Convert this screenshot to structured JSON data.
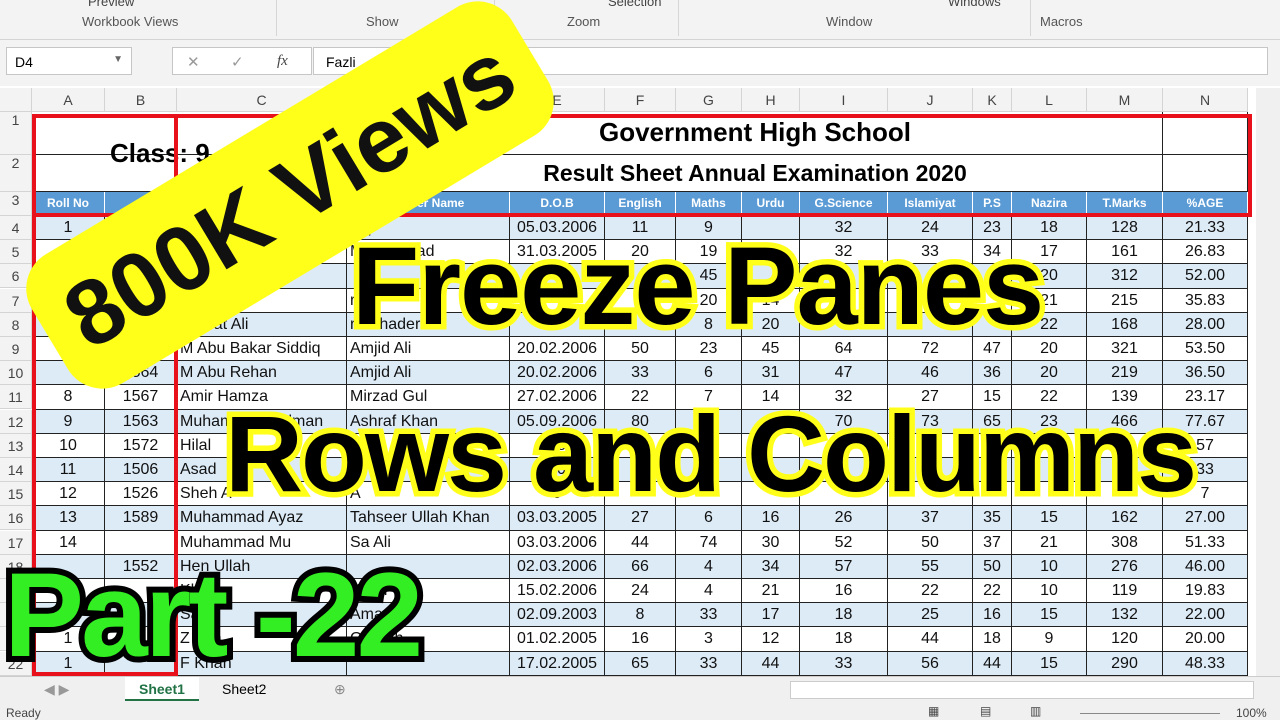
{
  "ribbon": {
    "top_items": [
      "Preview",
      "Selection",
      "Windows"
    ],
    "groups": [
      "Workbook Views",
      "Show",
      "Zoom",
      "Window",
      "Macros"
    ]
  },
  "formula_bar": {
    "name_box": "D4",
    "cancel": "✕",
    "enter": "✓",
    "fx": "fx",
    "value": "Fazli"
  },
  "columns": [
    "A",
    "B",
    "C",
    "D",
    "E",
    "F",
    "G",
    "H",
    "I",
    "J",
    "K",
    "L",
    "M",
    "N"
  ],
  "sheet": {
    "class_label": "Class: 9",
    "title": "Government High School",
    "subtitle": "Result Sheet Annual Examination 2020",
    "headers": [
      "Roll No",
      "",
      "",
      "Father Name",
      "D.O.B",
      "English",
      "Maths",
      "Urdu",
      "G.Science",
      "Islamiyat",
      "P.S",
      "Nazira",
      "T.Marks",
      "%AGE"
    ],
    "rows": [
      [
        "1",
        "",
        "",
        "diq",
        "05.03.2006",
        "11",
        "9",
        "",
        "32",
        "24",
        "23",
        "18",
        "128",
        "21.33"
      ],
      [
        "",
        "",
        "",
        "Muhammad",
        "31.03.2005",
        "20",
        "19",
        "1",
        "32",
        "33",
        "34",
        "17",
        "161",
        "26.83"
      ],
      [
        "",
        "",
        "Talha",
        "",
        "",
        "",
        "45",
        "",
        "",
        "",
        "",
        "20",
        "312",
        "52.00"
      ],
      [
        "",
        "",
        "",
        "rif U",
        "",
        "3",
        "20",
        "14",
        "",
        "",
        "",
        "21",
        "215",
        "35.83"
      ],
      [
        "",
        "",
        "Hazrat Ali",
        "r Bahader",
        "3",
        "",
        "8",
        "20",
        "",
        "",
        "",
        "22",
        "168",
        "28.00"
      ],
      [
        "",
        "",
        "M Abu Bakar Siddiq",
        "Amjid Ali",
        "20.02.2006",
        "50",
        "23",
        "45",
        "64",
        "72",
        "47",
        "20",
        "321",
        "53.50"
      ],
      [
        "",
        "1564",
        "M Abu Rehan",
        "Amjid Ali",
        "20.02.2006",
        "33",
        "6",
        "31",
        "47",
        "46",
        "36",
        "20",
        "219",
        "36.50"
      ],
      [
        "8",
        "1567",
        "Amir Hamza",
        "Mirzad Gul",
        "27.02.2006",
        "22",
        "7",
        "14",
        "32",
        "27",
        "15",
        "22",
        "139",
        "23.17"
      ],
      [
        "9",
        "1563",
        "Muhammad Salman",
        "Ashraf Khan",
        "05.09.2006",
        "80",
        "",
        "",
        "70",
        "73",
        "65",
        "23",
        "466",
        "77.67"
      ],
      [
        "10",
        "1572",
        "Hilal",
        "",
        "08",
        "",
        "",
        "",
        "",
        "",
        "",
        "",
        "",
        "57"
      ],
      [
        "11",
        "1506",
        "Asad",
        "",
        "10",
        "",
        "",
        "",
        "",
        "",
        "",
        "",
        "",
        "33"
      ],
      [
        "12",
        "1526",
        "Sheh A",
        "A",
        "0",
        "",
        "",
        "",
        "",
        "",
        "",
        "",
        "",
        "7"
      ],
      [
        "13",
        "1589",
        "Muhammad Ayaz",
        "Tahseer Ullah Khan",
        "03.03.2005",
        "27",
        "6",
        "16",
        "26",
        "37",
        "35",
        "15",
        "162",
        "27.00"
      ],
      [
        "14",
        "",
        "Muhammad Mu",
        "Sa Ali",
        "03.03.2006",
        "44",
        "74",
        "30",
        "52",
        "50",
        "37",
        "21",
        "308",
        "51.33"
      ],
      [
        "",
        "1552",
        "Hen Ullah",
        "",
        "02.03.2006",
        "66",
        "4",
        "34",
        "57",
        "55",
        "50",
        "10",
        "276",
        "46.00"
      ],
      [
        "",
        "",
        "Khan",
        "Khan",
        "15.02.2006",
        "24",
        "4",
        "21",
        "16",
        "22",
        "22",
        "10",
        "119",
        "19.83"
      ],
      [
        "",
        "",
        "San",
        "Amaah",
        "02.09.2003",
        "8",
        "33",
        "17",
        "18",
        "25",
        "16",
        "15",
        "132",
        "22.00"
      ],
      [
        "1",
        "",
        "Z Ulla",
        "O Ullah",
        "01.02.2005",
        "16",
        "3",
        "12",
        "18",
        "44",
        "18",
        "9",
        "120",
        "20.00"
      ],
      [
        "1",
        "",
        "F Khan",
        "",
        "17.02.2005",
        "65",
        "33",
        "44",
        "33",
        "56",
        "44",
        "15",
        "290",
        "48.33"
      ]
    ]
  },
  "tabs": [
    "Sheet1",
    "Sheet2"
  ],
  "status": {
    "text": "Ready",
    "zoom": "100%"
  },
  "overlays": {
    "views": "800K Views",
    "line1": "Freeze Panes",
    "line2": "Rows and Columns",
    "part": "Part -22"
  },
  "colors": {
    "header_blue": "#5b9bd5",
    "band": "#ddebf7",
    "red_box": "#e8101a",
    "yellow": "#ffff1a",
    "green": "#33ee22"
  }
}
